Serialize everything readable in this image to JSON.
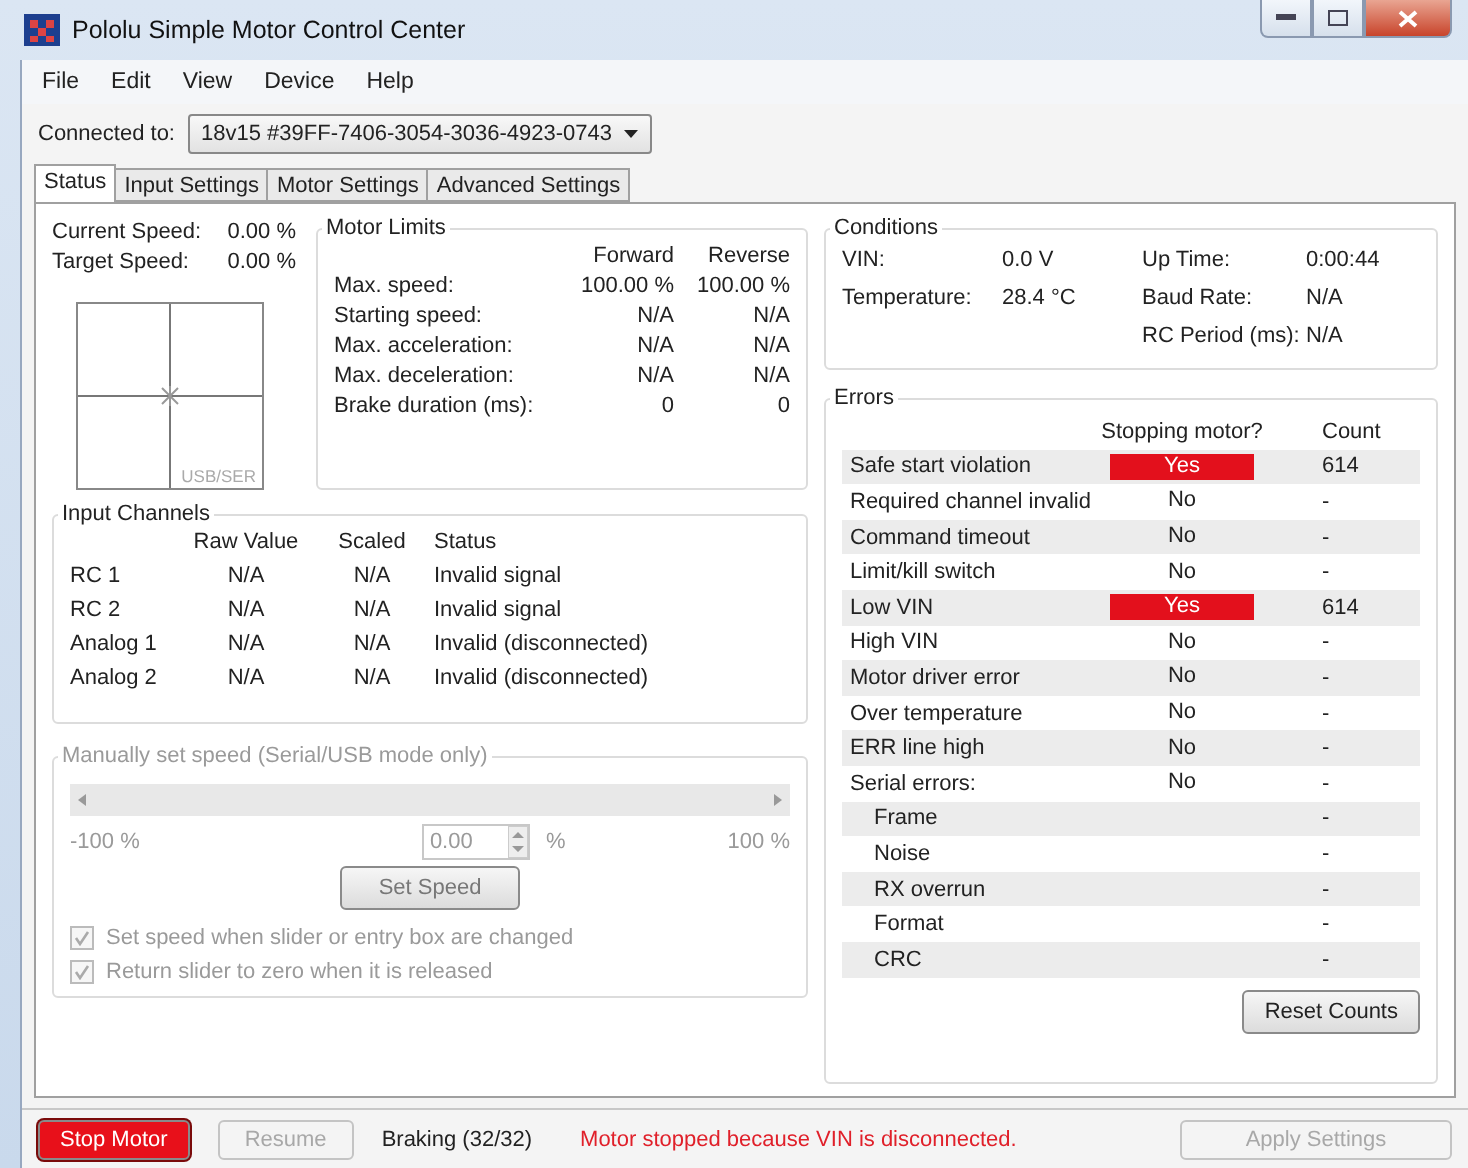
{
  "window": {
    "title": "Pololu Simple Motor Control Center"
  },
  "menu": [
    "File",
    "Edit",
    "View",
    "Device",
    "Help"
  ],
  "connection": {
    "label": "Connected to:",
    "device": "18v15 #39FF-7406-3054-3036-4923-0743"
  },
  "tabs": [
    {
      "label": "Status",
      "selected": true
    },
    {
      "label": "Input Settings",
      "selected": false
    },
    {
      "label": "Motor Settings",
      "selected": false
    },
    {
      "label": "Advanced Settings",
      "selected": false
    }
  ],
  "speed": {
    "rows": [
      {
        "label": "Current Speed:",
        "value": "0.00 %"
      },
      {
        "label": "Target Speed:",
        "value": "0.00 %"
      }
    ],
    "indicator_label": "USB/SER"
  },
  "motor_limits": {
    "title": "Motor Limits",
    "columns": [
      "Forward",
      "Reverse"
    ],
    "rows": [
      {
        "label": "Max. speed:",
        "forward": "100.00 %",
        "reverse": "100.00 %"
      },
      {
        "label": "Starting speed:",
        "forward": "N/A",
        "reverse": "N/A"
      },
      {
        "label": "Max. acceleration:",
        "forward": "N/A",
        "reverse": "N/A"
      },
      {
        "label": "Max. deceleration:",
        "forward": "N/A",
        "reverse": "N/A"
      },
      {
        "label": "Brake duration (ms):",
        "forward": "0",
        "reverse": "0"
      }
    ]
  },
  "input_channels": {
    "title": "Input Channels",
    "columns": [
      "Raw Value",
      "Scaled",
      "Status"
    ],
    "rows": [
      {
        "name": "RC 1",
        "raw": "N/A",
        "scaled": "N/A",
        "status": "Invalid signal"
      },
      {
        "name": "RC 2",
        "raw": "N/A",
        "scaled": "N/A",
        "status": "Invalid signal"
      },
      {
        "name": "Analog 1",
        "raw": "N/A",
        "scaled": "N/A",
        "status": "Invalid (disconnected)"
      },
      {
        "name": "Analog 2",
        "raw": "N/A",
        "scaled": "N/A",
        "status": "Invalid (disconnected)"
      }
    ]
  },
  "manual_speed": {
    "title": "Manually set speed (Serial/USB mode only)",
    "disabled": true,
    "min_label": "-100 %",
    "max_label": "100 %",
    "value": "0.00",
    "unit": "%",
    "button": "Set Speed",
    "options": [
      {
        "label": "Set speed when slider or entry box are changed",
        "checked": true
      },
      {
        "label": "Return slider to zero when it is released",
        "checked": true
      }
    ]
  },
  "conditions": {
    "title": "Conditions",
    "left": [
      {
        "label": "VIN:",
        "value": "0.0 V"
      },
      {
        "label": "Temperature:",
        "value": "28.4 °C"
      }
    ],
    "right": [
      {
        "label": "Up Time:",
        "value": "0:00:44"
      },
      {
        "label": "Baud Rate:",
        "value": "N/A"
      },
      {
        "label": "RC Period (ms):",
        "value": "N/A"
      }
    ]
  },
  "errors": {
    "title": "Errors",
    "columns": [
      "Stopping motor?",
      "Count"
    ],
    "rows": [
      {
        "name": "Safe start violation",
        "stopping": "Yes",
        "alarm": true,
        "count": "614"
      },
      {
        "name": "Required channel invalid",
        "stopping": "No",
        "alarm": false,
        "count": "-"
      },
      {
        "name": "Command timeout",
        "stopping": "No",
        "alarm": false,
        "count": "-"
      },
      {
        "name": "Limit/kill switch",
        "stopping": "No",
        "alarm": false,
        "count": "-"
      },
      {
        "name": "Low VIN",
        "stopping": "Yes",
        "alarm": true,
        "count": "614"
      },
      {
        "name": "High VIN",
        "stopping": "No",
        "alarm": false,
        "count": "-"
      },
      {
        "name": "Motor driver error",
        "stopping": "No",
        "alarm": false,
        "count": "-"
      },
      {
        "name": "Over temperature",
        "stopping": "No",
        "alarm": false,
        "count": "-"
      },
      {
        "name": "ERR line high",
        "stopping": "No",
        "alarm": false,
        "count": "-"
      },
      {
        "name": "Serial errors:",
        "stopping": "No",
        "alarm": false,
        "count": "-",
        "children": [
          {
            "name": "Frame",
            "count": "-"
          },
          {
            "name": "Noise",
            "count": "-"
          },
          {
            "name": "RX overrun",
            "count": "-"
          },
          {
            "name": "Format",
            "count": "-"
          },
          {
            "name": "CRC",
            "count": "-"
          }
        ]
      }
    ],
    "reset_button": "Reset Counts"
  },
  "status_bar": {
    "stop_button": "Stop Motor",
    "resume_button": {
      "label": "Resume",
      "disabled": true
    },
    "state": "Braking (32/32)",
    "message": "Motor stopped because VIN is disconnected.",
    "apply_button": {
      "label": "Apply Settings",
      "disabled": true
    }
  }
}
